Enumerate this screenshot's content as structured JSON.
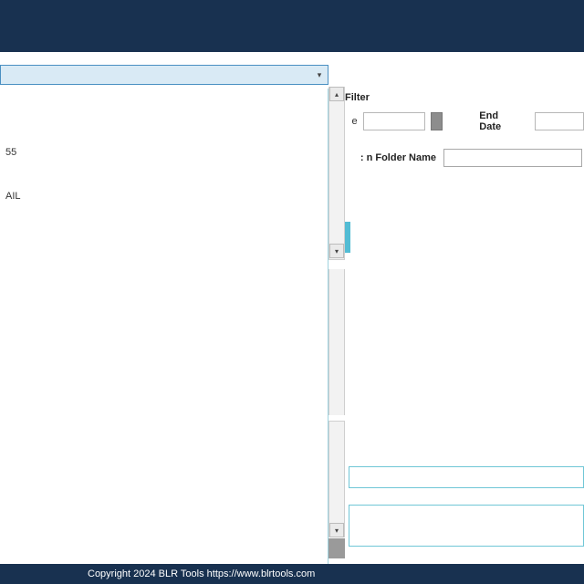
{
  "topbar": {},
  "dropdown": {
    "selected": ""
  },
  "left": {
    "items": [
      "55",
      "AIL"
    ]
  },
  "right": {
    "filter_header": "Filter",
    "start_partial": "e",
    "end_label": "End Date",
    "folder_label": "n Folder Name :"
  },
  "footer": {
    "text": "Copyright 2024 BLR Tools https://www.blrtools.com"
  }
}
